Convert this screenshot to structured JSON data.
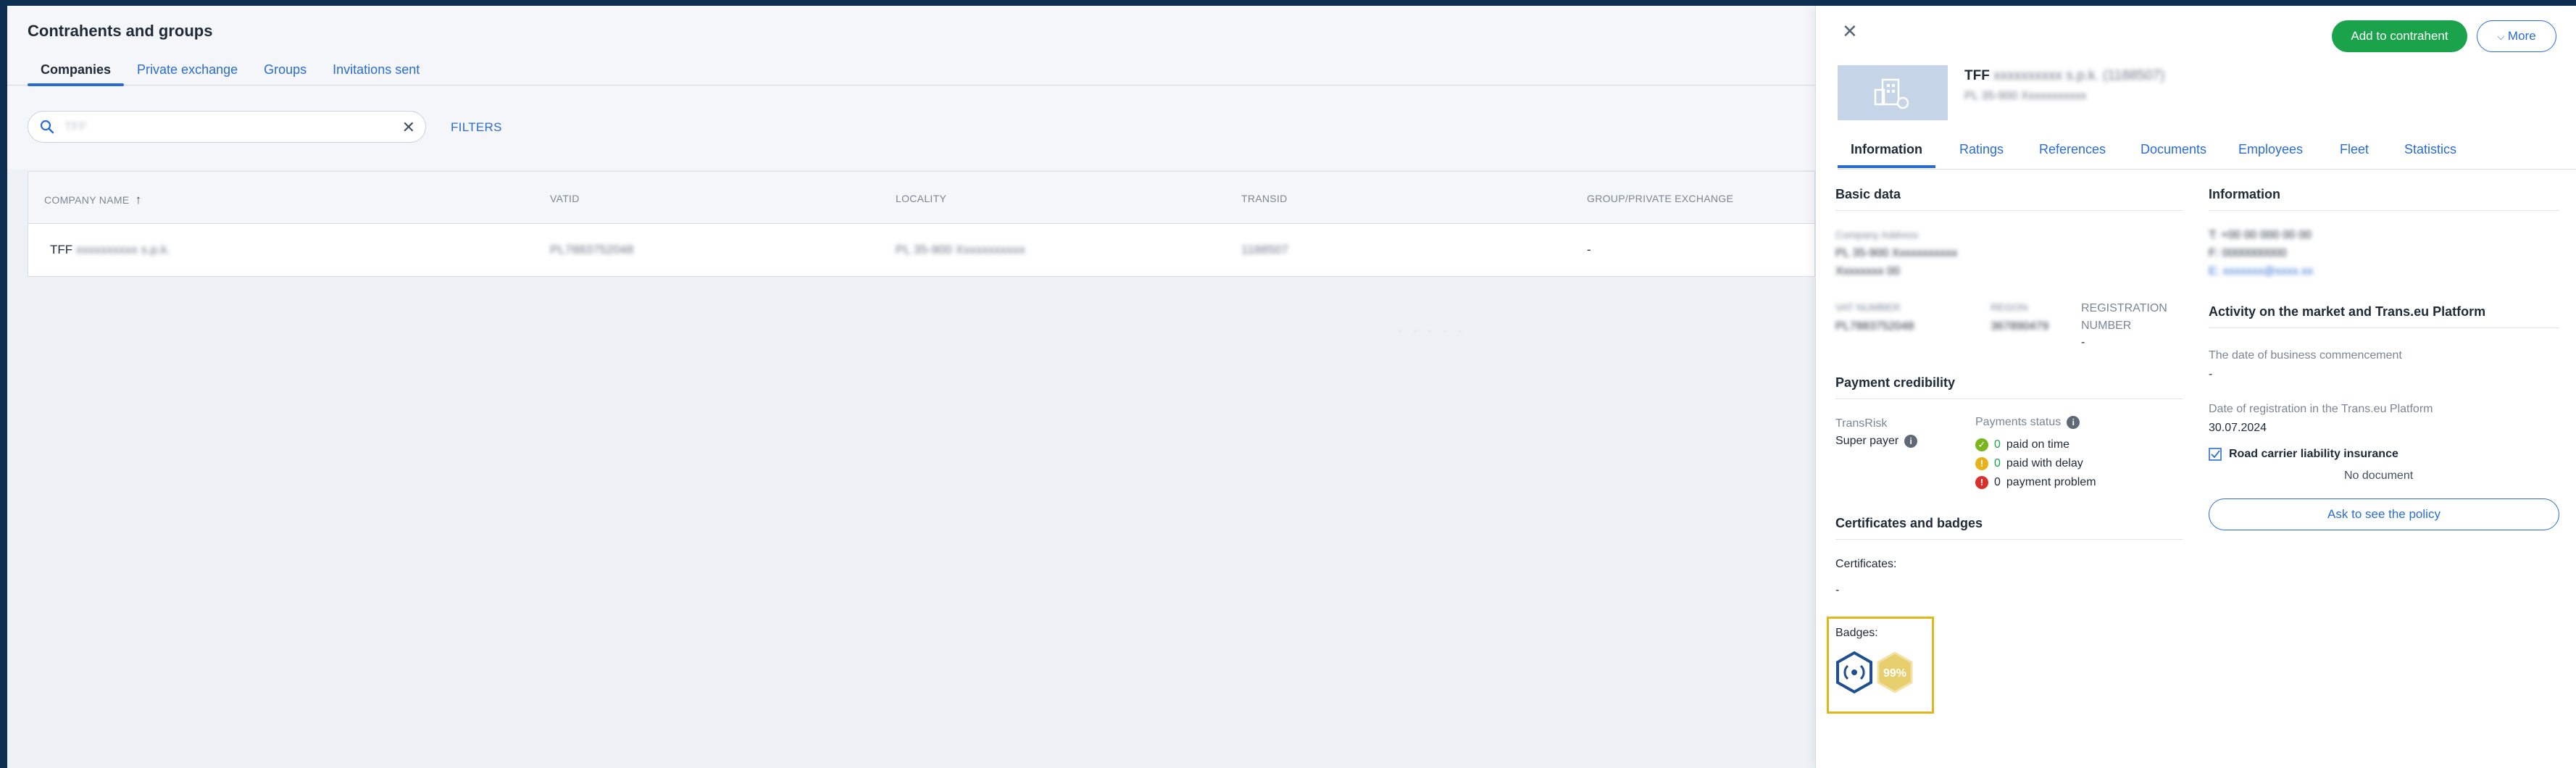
{
  "page": {
    "title": "Contrahents and groups"
  },
  "tabs": [
    {
      "label": "Companies"
    },
    {
      "label": "Private exchange"
    },
    {
      "label": "Groups"
    },
    {
      "label": "Invitations sent"
    }
  ],
  "search": {
    "value": "TFF",
    "clear_icon": "close-icon",
    "search_icon": "search-icon"
  },
  "filters_label": "FILTERS",
  "table": {
    "columns": [
      "COMPANY NAME",
      "VATID",
      "LOCALITY",
      "TRANSID",
      "GROUP/PRIVATE EXCHANGE"
    ],
    "rows": [
      {
        "company": "TFF",
        "company_blur": "xxxxxxxxxx s.p.k.",
        "vatid": "PL7883752048",
        "locality": "PL 35-900 Xxxxxxxxxxx",
        "transid": "1188507",
        "group": "-"
      }
    ],
    "loading_text": "· · · · ·"
  },
  "panel": {
    "close_icon": "close-icon",
    "add_button": "Add to contrahent",
    "more_button": "More",
    "company": {
      "name": "TFF",
      "name_blur": "xxxxxxxxxx s.p.k. (1188507)",
      "sub_blur": "PL 35-900 Xxxxxxxxxxx"
    },
    "tabs": [
      "Information",
      "Ratings",
      "References",
      "Documents",
      "Employees",
      "Fleet",
      "Statistics"
    ],
    "basic": {
      "title": "Basic data",
      "addr_label": "Company Address",
      "addr_line1": "PL 35-900 Xxxxxxxxxxx",
      "addr_line2": "Xxxxxxxx 00",
      "vat_label": "VAT NUMBER",
      "vat_value": "PL7883752048",
      "regon_label": "REGON",
      "regon_value": "367890479",
      "reg_label_1": "REGISTRATION",
      "reg_label_2": "NUMBER",
      "reg_value": "-"
    },
    "info": {
      "title": "Information",
      "phone": "T: +00 00 000 00 00",
      "fax": "F: 0000000000",
      "email": "E: xxxxxxx@xxxx.xx"
    },
    "activity": {
      "title": "Activity on the market and Trans.eu Platform",
      "commence_label": "The date of business commencement",
      "commence_value": "-",
      "reg_label": "Date of registration in the Trans.eu Platform",
      "reg_value": "30.07.2024",
      "insurance_label": "Road carrier liability insurance",
      "no_document": "No document",
      "ask_button": "Ask to see the policy"
    },
    "payment": {
      "title": "Payment credibility",
      "transrisk_label": "TransRisk",
      "transrisk_value": "Super payer",
      "status_label": "Payments status",
      "rows": [
        {
          "count": "0",
          "text": "paid on time",
          "color": "#7ab51d",
          "icon": "check-icon"
        },
        {
          "count": "0",
          "text": "paid with delay",
          "color": "#e8b21a",
          "icon": "warning-icon"
        },
        {
          "count": "0",
          "text": "payment problem",
          "color": "#d9302c",
          "icon": "alert-icon"
        }
      ]
    },
    "certs": {
      "title": "Certificates and badges",
      "certs_label": "Certificates:",
      "certs_value": "-",
      "badges_label": "Badges:",
      "badge2_text": "99%"
    }
  },
  "colors": {
    "accent": "#2b6cd1",
    "green": "#1aa34a",
    "badge_frame": "#e2b71b",
    "nav_dark": "#0f2f52"
  }
}
